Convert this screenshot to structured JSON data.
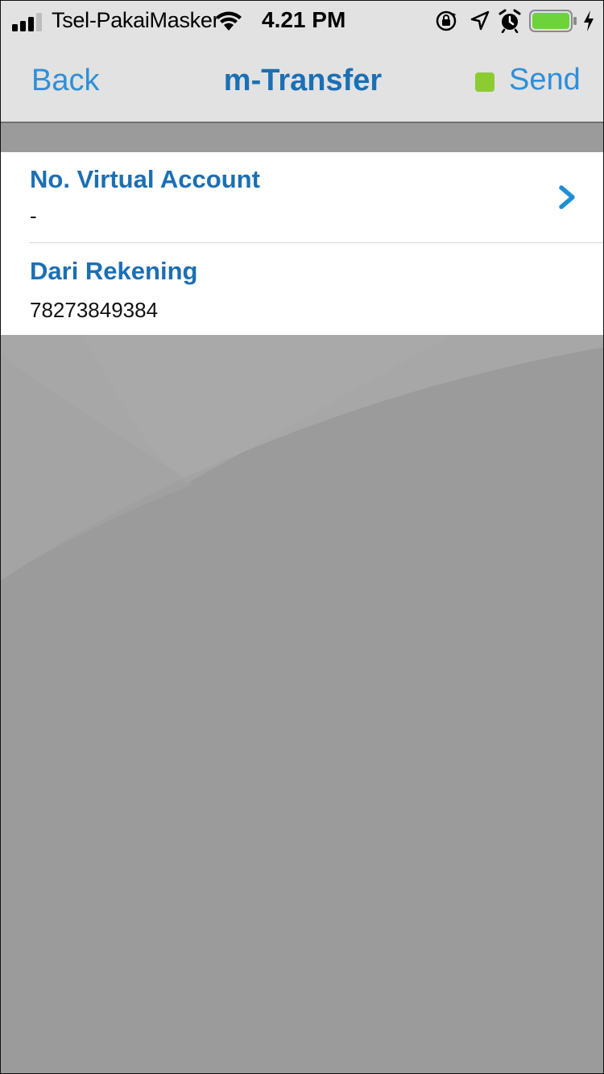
{
  "status_bar": {
    "carrier": "Tsel-PakaiMasker",
    "time": "4.21 PM",
    "icons": [
      "signal-icon",
      "wifi-icon",
      "rotation-lock-icon",
      "location-icon",
      "alarm-icon",
      "battery-icon",
      "charging-icon"
    ],
    "battery_level": 1.0,
    "battery_color": "#6ed33a"
  },
  "nav": {
    "back_label": "Back",
    "title": "m-Transfer",
    "send_label": "Send",
    "status_dot_color": "#8ccc32",
    "accent_color": "#2f8fd8",
    "title_color": "#1c6fb3"
  },
  "form": {
    "rows": [
      {
        "label": "No. Virtual Account",
        "value": "-",
        "icon": "chevron-right-icon"
      },
      {
        "label": "Dari Rekening",
        "value": "78273849384"
      }
    ]
  }
}
